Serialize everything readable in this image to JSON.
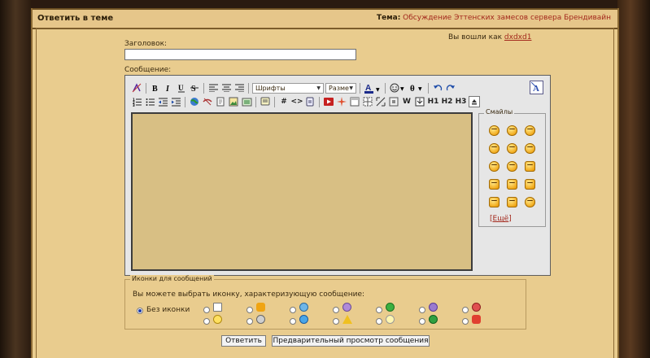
{
  "page": {
    "title": "Ответить в теме",
    "topic_label": "Тема:",
    "topic_name": "Обсуждение Эттенских замесов сервера Брендивайн"
  },
  "form": {
    "subject_label": "Заголовок:",
    "subject_value": "",
    "message_label": "Сообщение:",
    "logged_in_text": "Вы вошли как",
    "username": "dxdxd1"
  },
  "toolbar": {
    "font_label": "Шрифты",
    "size_label": "Разме",
    "h1": "H1",
    "h2": "H2",
    "h3": "H3",
    "hash": "#",
    "code": "<>",
    "wiki": "W"
  },
  "smilies": {
    "legend": "Смайлы",
    "more_label": "[Ещё]",
    "more_link": "Ещё",
    "icons": [
      "smile-icon",
      "big-smile-icon",
      "grin-icon",
      "wink-icon",
      "cool-icon",
      "crying-icon",
      "embarrassed-icon",
      "angry-icon",
      "thumbs-up-icon",
      "thumbs-down-icon",
      "stop-hand-icon",
      "pointing-hand-icon",
      "pointing-up-icon",
      "victory-icon",
      "confused-icon"
    ]
  },
  "post_icons": {
    "legend": "Иконки для сообщений",
    "description": "Вы можете выбрать иконку, характеризующую сообщение:",
    "no_icon_label": "Без иконки",
    "selected": "Без иконки",
    "icons": [
      "note-icon",
      "thumbs-up-icon",
      "grin-icon",
      "purple-smile-icon",
      "green-helmet-icon",
      "purple-devil-icon",
      "angry-icon",
      "smile-icon",
      "cool-icon",
      "blue-smile-icon",
      "warning-icon",
      "lightbulb-icon",
      "green-arrow-icon",
      "thumbs-down-icon"
    ]
  },
  "actions": {
    "reply": "Ответить",
    "preview": "Предварительный просмотр сообщения"
  }
}
